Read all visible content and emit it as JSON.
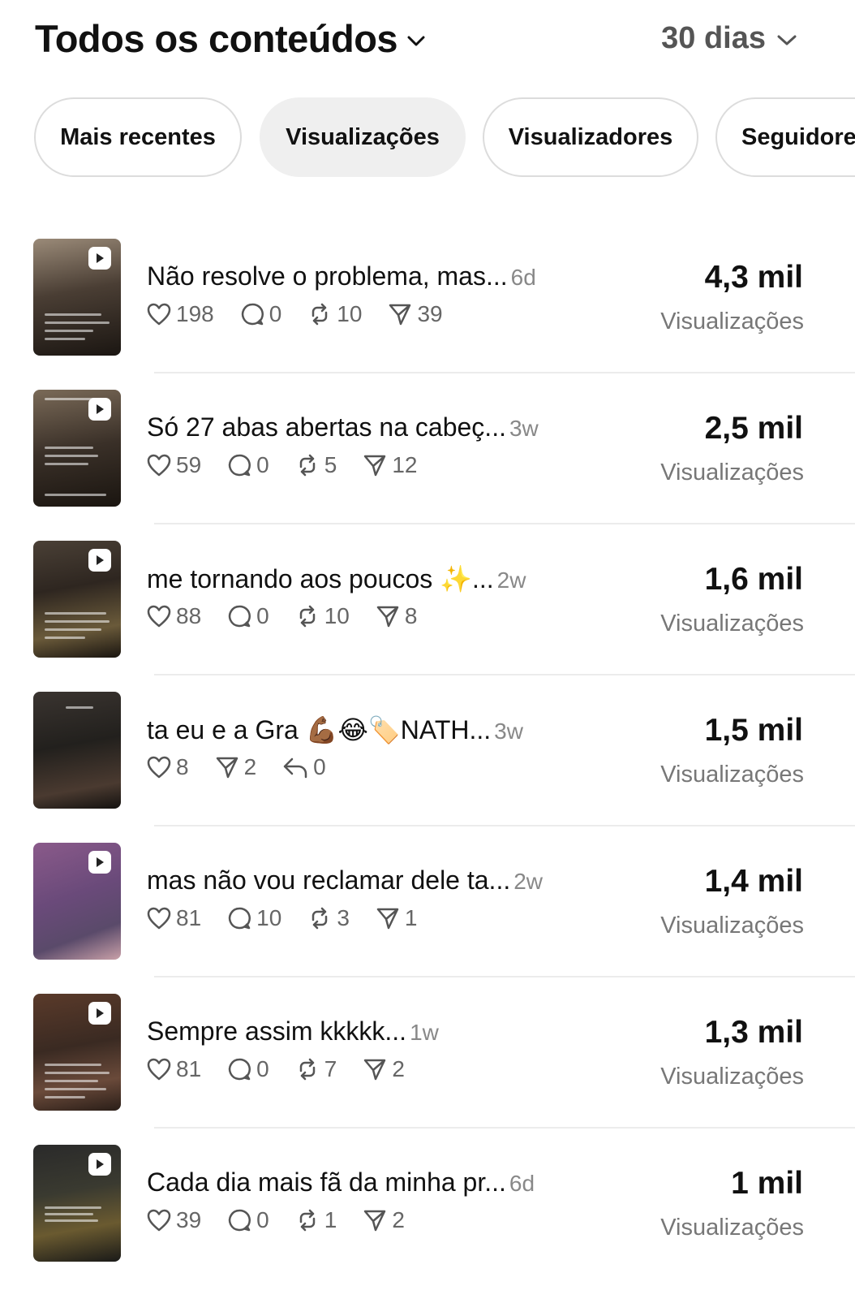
{
  "header": {
    "title": "Todos os conteúdos",
    "range": "30 dias"
  },
  "filters": [
    "Mais recentes",
    "Visualizações",
    "Visualizadores",
    "Seguidores"
  ],
  "posts": [
    {
      "caption": "Não resolve o problema, mas...",
      "age": "6d",
      "likes": "198",
      "replies": "0",
      "reposts": "10",
      "shares": "39",
      "views": "4,3 mil",
      "views_label": "Visualizações"
    },
    {
      "caption": "Só 27 abas abertas na cabeç...",
      "age": "3w",
      "likes": "59",
      "replies": "0",
      "reposts": "5",
      "shares": "12",
      "views": "2,5 mil",
      "views_label": "Visualizações"
    },
    {
      "caption": "me tornando aos poucos ✨...",
      "age": "2w",
      "likes": "88",
      "replies": "0",
      "reposts": "10",
      "shares": "8",
      "views": "1,6 mil",
      "views_label": "Visualizações"
    },
    {
      "caption": "ta eu e a Gra 💪🏾😂🏷️NATH...",
      "age": "3w",
      "likes": "8",
      "shares": "2",
      "quotes": "0",
      "views": "1,5 mil",
      "views_label": "Visualizações"
    },
    {
      "caption": "mas não vou reclamar dele ta...",
      "age": "2w",
      "likes": "81",
      "replies": "10",
      "reposts": "3",
      "shares": "1",
      "views": "1,4 mil",
      "views_label": "Visualizações"
    },
    {
      "caption": "Sempre assim kkkkk...",
      "age": "1w",
      "likes": "81",
      "replies": "0",
      "reposts": "7",
      "shares": "2",
      "views": "1,3 mil",
      "views_label": "Visualizações"
    },
    {
      "caption": "Cada dia mais fã da minha pr...",
      "age": "6d",
      "likes": "39",
      "replies": "0",
      "reposts": "1",
      "shares": "2",
      "views": "1 mil",
      "views_label": "Visualizações"
    }
  ]
}
